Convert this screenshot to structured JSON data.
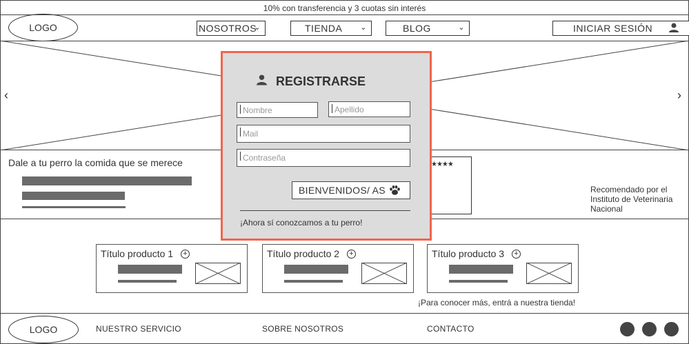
{
  "promo": {
    "text": "10% con transferencia y 3 cuotas sin interés"
  },
  "header": {
    "logo": "LOGO",
    "nav": [
      "NOSOTROS",
      "TIENDA",
      "BLOG"
    ],
    "login": "INICIAR SESIÓN"
  },
  "hero": {
    "prev_icon": "chevron-left-icon",
    "next_icon": "chevron-right-icon"
  },
  "info": {
    "headline": "Dale a tu perro la comida que se merece",
    "rating": "★★★★",
    "recommended": "Recomendado por el Instituto de Veterinaria Nacional"
  },
  "modal": {
    "title": "REGISTRARSE",
    "name_placeholder": "Nombre",
    "lastname_placeholder": "Apellido",
    "mail_placeholder": "Mail",
    "password_placeholder": "Contraseña",
    "submit": "BIENVENIDOS/ AS",
    "footer_text": "¡Ahora sí conozcamos a tu perro!",
    "border_color": "#f0654d"
  },
  "products": [
    {
      "title": "Título producto 1"
    },
    {
      "title": "Título producto 2"
    },
    {
      "title": "Título producto 3"
    }
  ],
  "store_cta": "¡Para conocer más, entrá a nuestra tienda!",
  "footer": {
    "logo": "LOGO",
    "links": [
      "NUESTRO SERVICIO",
      "SOBRE NOSOTROS",
      "CONTACTO"
    ],
    "social_icons": [
      "social-icon-1",
      "social-icon-2",
      "social-icon-3"
    ]
  }
}
